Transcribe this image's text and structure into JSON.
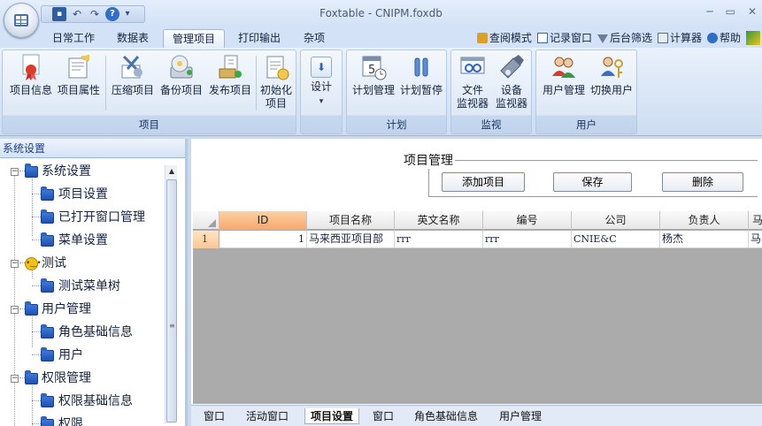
{
  "window": {
    "title": "Foxtable - CNIPM.foxdb",
    "controls": {
      "minimize": "─",
      "maximize": "▭",
      "close": "✕"
    }
  },
  "quick_access": {
    "dropdown": "▾"
  },
  "tabs": [
    {
      "label": "日常工作",
      "active": false
    },
    {
      "label": "数据表",
      "active": false
    },
    {
      "label": "管理项目",
      "active": true
    },
    {
      "label": "打印输出",
      "active": false
    },
    {
      "label": "杂项",
      "active": false
    }
  ],
  "toolbar_right": [
    {
      "label": "查阅模式",
      "icon": "lock-icon"
    },
    {
      "label": "记录窗口",
      "icon": "window-icon"
    },
    {
      "label": "后台筛选",
      "icon": "filter-icon"
    },
    {
      "label": "计算器",
      "icon": "calculator-icon"
    },
    {
      "label": "帮助",
      "icon": "help-icon"
    }
  ],
  "ribbon": {
    "groups": [
      {
        "label": "项目",
        "buttons": [
          "项目信息",
          "项目属性",
          "压缩项目",
          "备份项目",
          "发布项目",
          "初始化项目"
        ]
      },
      {
        "label": "",
        "buttons": [
          "设计"
        ]
      },
      {
        "label": "计划",
        "buttons": [
          "计划管理",
          "计划暂停"
        ]
      },
      {
        "label": "监视",
        "buttons": [
          "文件监视器",
          "设备监视器"
        ]
      },
      {
        "label": "用户",
        "buttons": [
          "用户管理",
          "切换用户"
        ]
      }
    ],
    "labels": {
      "proj_info": "项目信息",
      "proj_attr": "项目属性",
      "compress": "压缩项目",
      "backup": "备份项目",
      "publish": "发布项目",
      "init_l1": "初始化",
      "init_l2": "项目",
      "design": "设计",
      "design_arrow": "▾",
      "plan_mgr": "计划管理",
      "plan_pause": "计划暂停",
      "file_l1": "文件",
      "file_l2": "监视器",
      "dev_l1": "设备",
      "dev_l2": "监视器",
      "user_mgr": "用户管理",
      "switch_user": "切换用户",
      "group_project": "项目",
      "group_plan": "计划",
      "group_monitor": "监视",
      "group_user": "用户",
      "calendar_day": "5"
    }
  },
  "left_panel": {
    "title": "系统设置",
    "tree": [
      {
        "label": "系统设置",
        "level": 0,
        "expander": "−"
      },
      {
        "label": "项目设置",
        "level": 1
      },
      {
        "label": "已打开窗口管理",
        "level": 1
      },
      {
        "label": "菜单设置",
        "level": 1
      },
      {
        "label": "测试",
        "level": 0,
        "expander": "−"
      },
      {
        "label": "测试菜单树",
        "level": 1
      },
      {
        "label": "用户管理",
        "level": 0,
        "expander": "−"
      },
      {
        "label": "角色基础信息",
        "level": 1
      },
      {
        "label": "用户",
        "level": 1
      },
      {
        "label": "权限管理",
        "level": 0,
        "expander": "−"
      },
      {
        "label": "权限基础信息",
        "level": 1
      },
      {
        "label": "权限",
        "level": 1
      }
    ],
    "scroll_up": "▲",
    "grip": "≡"
  },
  "form": {
    "title": "项目管理",
    "buttons": {
      "add": "添加项目",
      "save": "保存",
      "delete": "删除"
    }
  },
  "grid": {
    "columns": [
      "ID",
      "项目名称",
      "英文名称",
      "编号",
      "公司",
      "负责人",
      "马"
    ],
    "rows": [
      {
        "row_no": "1",
        "id": "1",
        "name": "马来西亚项目部",
        "en_name": "rrr",
        "code": "rrr",
        "company": "CNIE&C",
        "manager": "杨杰",
        "extra": "马"
      }
    ]
  },
  "bottom_tabs": [
    {
      "label": "窗口",
      "active": false
    },
    {
      "label": "活动窗口",
      "active": false
    },
    {
      "label": "项目设置",
      "active": true
    },
    {
      "label": "窗口",
      "active": false
    },
    {
      "label": "角色基础信息",
      "active": false
    },
    {
      "label": "用户管理",
      "active": false
    }
  ],
  "colors": {
    "accent": "#f7a86c",
    "ribbon_bg": "#d5e3f5",
    "folder": "#2f64c4"
  }
}
